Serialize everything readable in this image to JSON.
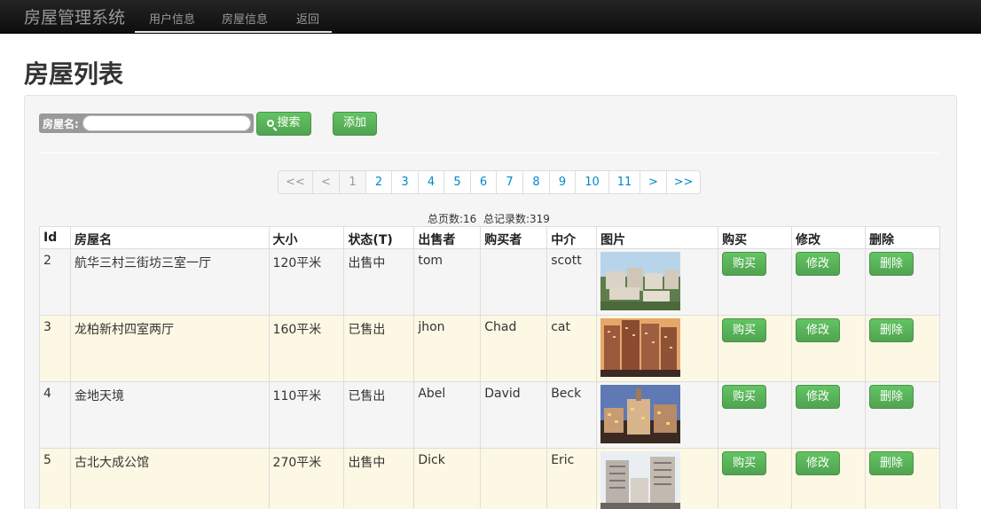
{
  "navbar": {
    "brand": "房屋管理系统",
    "items": [
      "用户信息",
      "房屋信息",
      "返回"
    ]
  },
  "page": {
    "title": "房屋列表"
  },
  "search": {
    "label": "房屋名:",
    "value": "",
    "search_label": "搜索",
    "add_label": "添加"
  },
  "pagination": {
    "items": [
      "<<",
      "<",
      "1",
      "2",
      "3",
      "4",
      "5",
      "6",
      "7",
      "8",
      "9",
      "10",
      "11",
      ">",
      ">>"
    ],
    "current": "1"
  },
  "summary": {
    "text": "总页数:16  总记录数:319"
  },
  "table": {
    "headers": [
      "Id",
      "房屋名",
      "大小",
      "状态(T)",
      "出售者",
      "购买者",
      "中介",
      "图片",
      "购买",
      "修改",
      "删除"
    ],
    "action_labels": {
      "buy": "购买",
      "edit": "修改",
      "delete": "删除"
    },
    "rows": [
      {
        "id": "2",
        "name": "航华三村三街坊三室一厅",
        "size": "120平米",
        "status": "出售中",
        "seller": "tom",
        "buyer": "",
        "agent": "scott",
        "image": "residential-complex-photo"
      },
      {
        "id": "3",
        "name": "龙柏新村四室两厅",
        "size": "160平米",
        "status": "已售出",
        "seller": "jhon",
        "buyer": "Chad",
        "agent": "cat",
        "image": "high-rise-sunset-photo"
      },
      {
        "id": "4",
        "name": "金地天境",
        "size": "110平米",
        "status": "已售出",
        "seller": "Abel",
        "buyer": "David",
        "agent": "Beck",
        "image": "commercial-street-photo"
      },
      {
        "id": "5",
        "name": "古北大成公馆",
        "size": "270平米",
        "status": "出售中",
        "seller": "Dick",
        "buyer": "",
        "agent": "Eric",
        "image": "apartment-towers-photo"
      }
    ]
  }
}
